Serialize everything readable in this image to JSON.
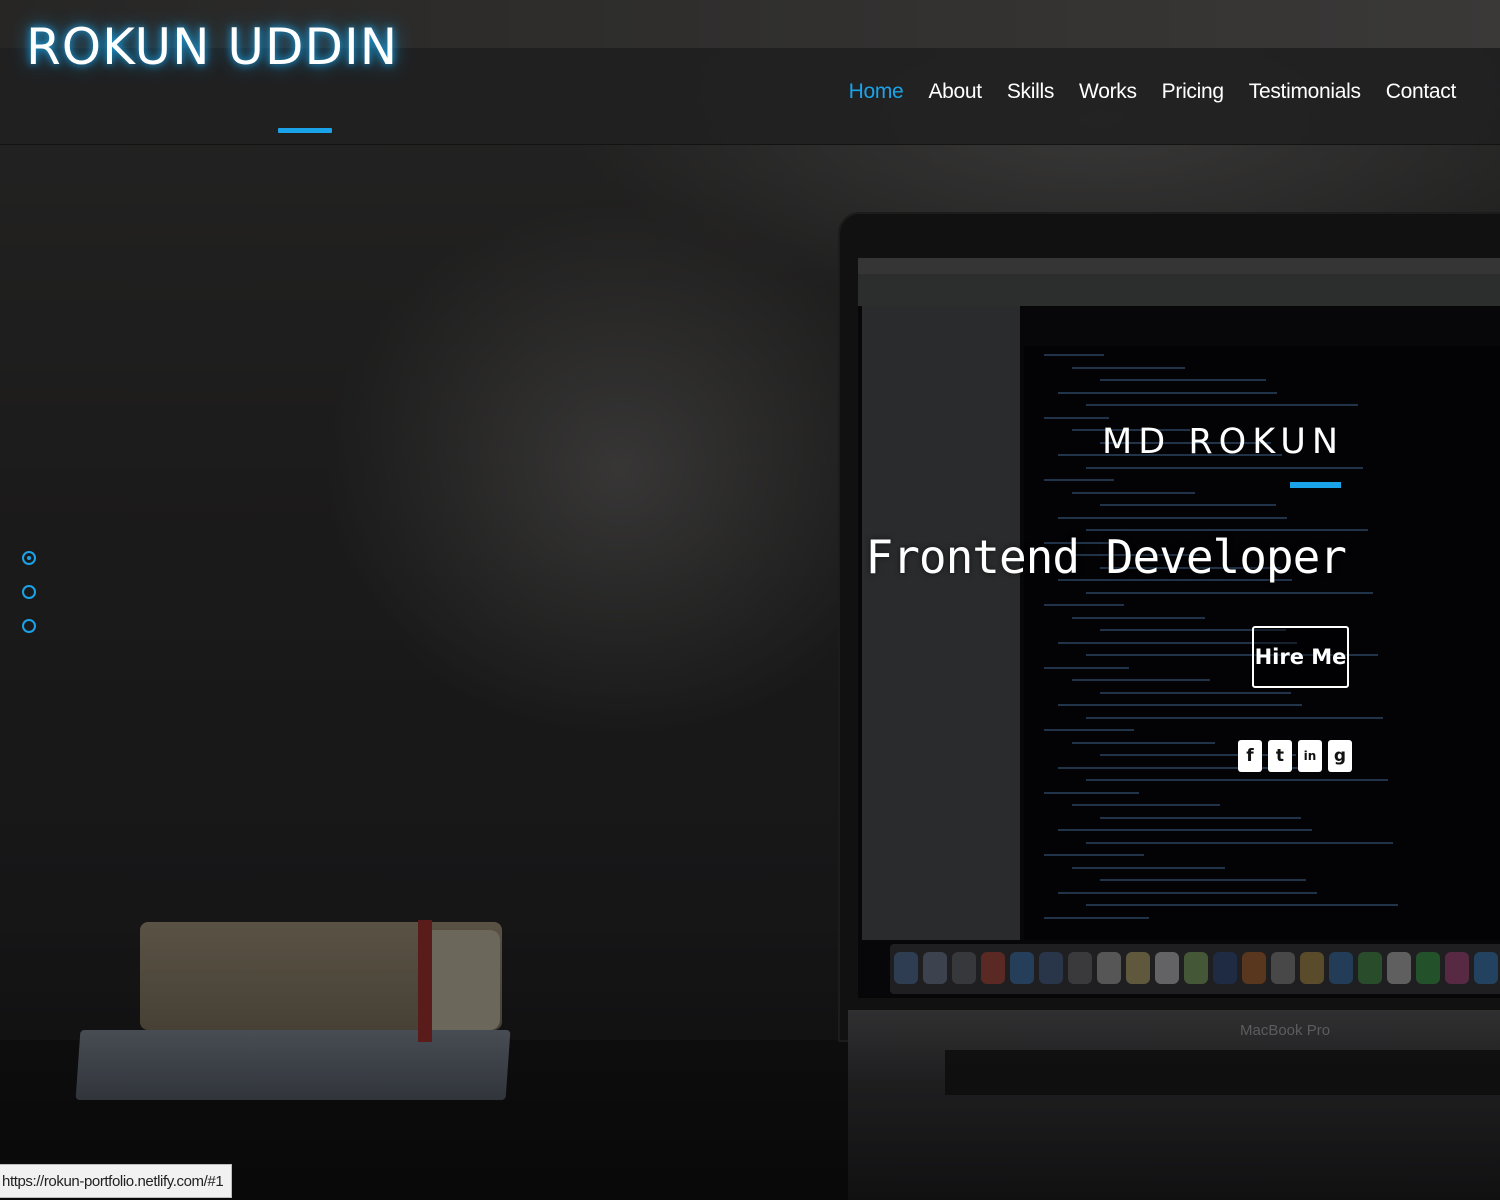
{
  "brand": {
    "name": "ROKUN UDDIN"
  },
  "nav": {
    "items": [
      {
        "label": "Home",
        "active": true
      },
      {
        "label": "About",
        "active": false
      },
      {
        "label": "Skills",
        "active": false
      },
      {
        "label": "Works",
        "active": false
      },
      {
        "label": "Pricing",
        "active": false
      },
      {
        "label": "Testimonials",
        "active": false
      },
      {
        "label": "Contact",
        "active": false
      }
    ]
  },
  "hero": {
    "name": "MD ROKUN",
    "role": "Frontend Developer",
    "cta_label": "Hire Me",
    "socials": [
      {
        "icon": "facebook-icon",
        "glyph": "f"
      },
      {
        "icon": "twitter-icon",
        "glyph": "t"
      },
      {
        "icon": "linkedin-icon",
        "glyph": "in"
      },
      {
        "icon": "github-icon",
        "glyph": "g"
      }
    ]
  },
  "background": {
    "laptop_brand": "MacBook Pro"
  },
  "slider": {
    "dots": 3,
    "active_index": 0
  },
  "status_bar": {
    "url": "https://rokun-portfolio.netlify.com/#1"
  },
  "colors": {
    "accent": "#1aa3e8",
    "navbar": "#202021",
    "text": "#ffffff"
  }
}
